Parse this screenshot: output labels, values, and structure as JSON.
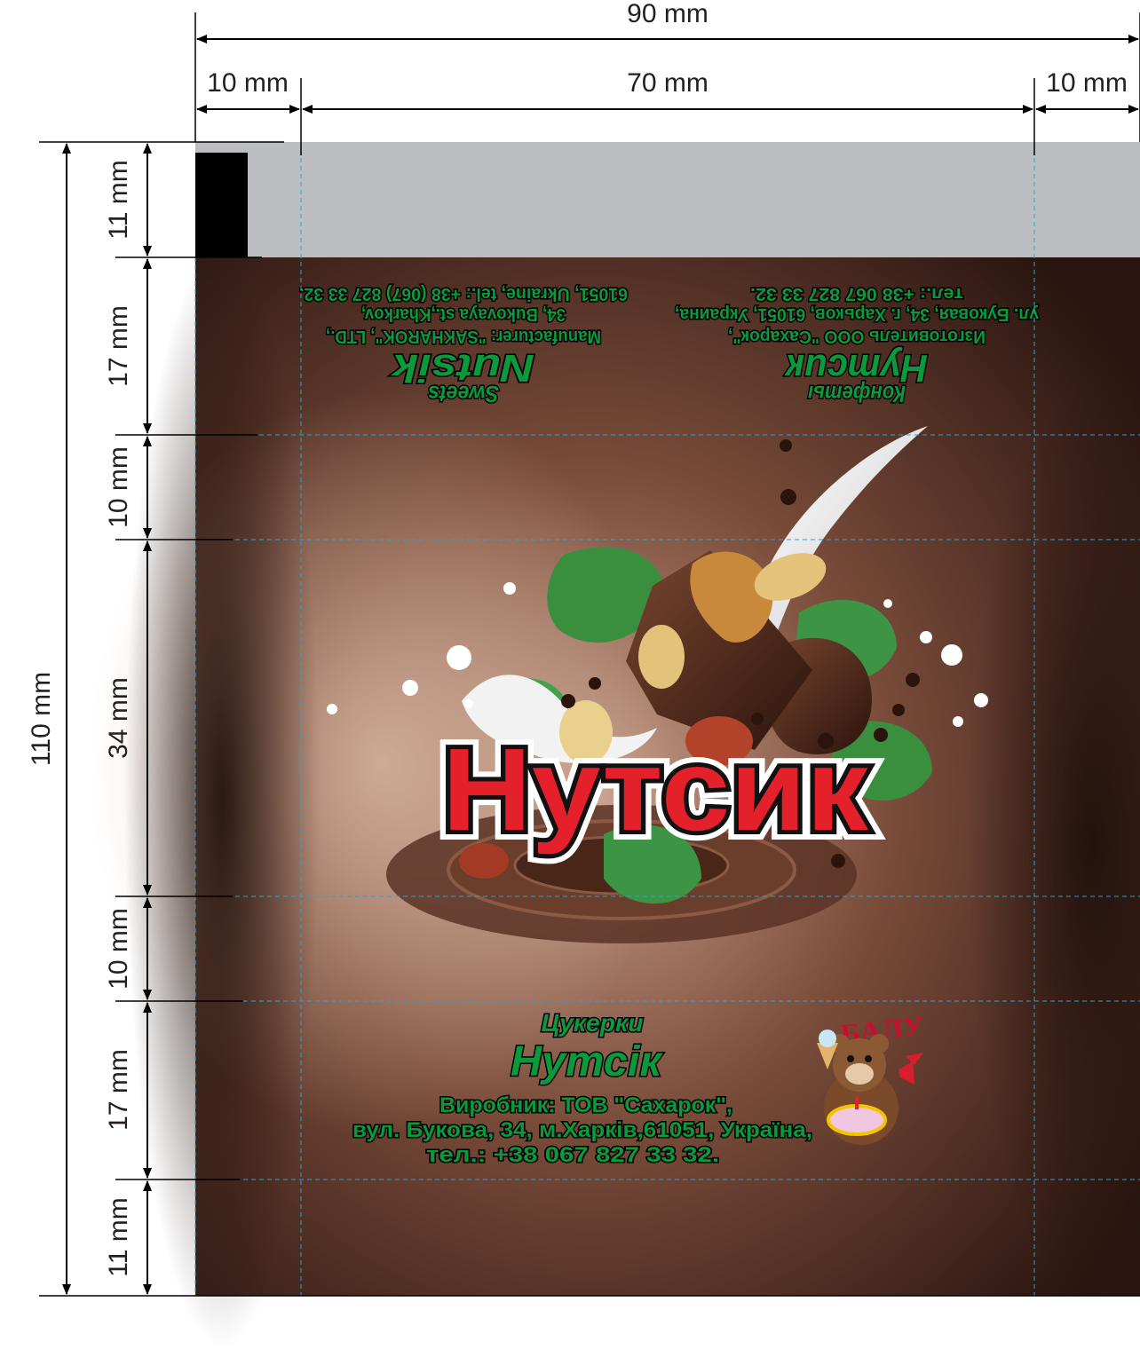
{
  "dimensions": {
    "total_width": "90 mm",
    "left_margin": "10 mm",
    "content_width": "70 mm",
    "right_margin": "10 mm",
    "total_height": "110 mm",
    "rows": [
      "11 mm",
      "17 mm",
      "10 mm",
      "34 mm",
      "10 mm",
      "17 mm",
      "11 mm"
    ]
  },
  "colors": {
    "top_band": "#bcbdc0",
    "marker": "#000000",
    "guide_line": "#29a3d6",
    "text_green": "#0a9a3c",
    "brand_red": "#e4202a",
    "background_dark": "#2a1510",
    "background_light": "#b58a72"
  },
  "top_section": {
    "ru": {
      "heading": "Конфеты",
      "name": "Нутсик",
      "lines": [
        "Изготовитель ООО \"Сахарок\",",
        "ул. Буковая, 34, г. Харьков, 61051, Украина,",
        "тел.: +38 067 827 33 32."
      ]
    },
    "en": {
      "heading": "Sweets",
      "name": "Nutsik",
      "lines": [
        "Manufacturer: \"SAKHAROK\", LTD.,",
        "34, Bukovaya st.,Kharkov,",
        "61051, Ukraine, tel.: +38 (067) 827 33 32."
      ]
    }
  },
  "center": {
    "brand": "Нутсик"
  },
  "bottom_section": {
    "heading": "Цукерки",
    "name": "Нутсік",
    "lines": [
      "Виробник: ТОВ \"Сахарок\",",
      "вул. Букова, 34, м.Харків,61051, Україна,",
      "тел.: +38 067 827 33 32."
    ]
  },
  "mascot": {
    "label": "БАЛУ"
  }
}
